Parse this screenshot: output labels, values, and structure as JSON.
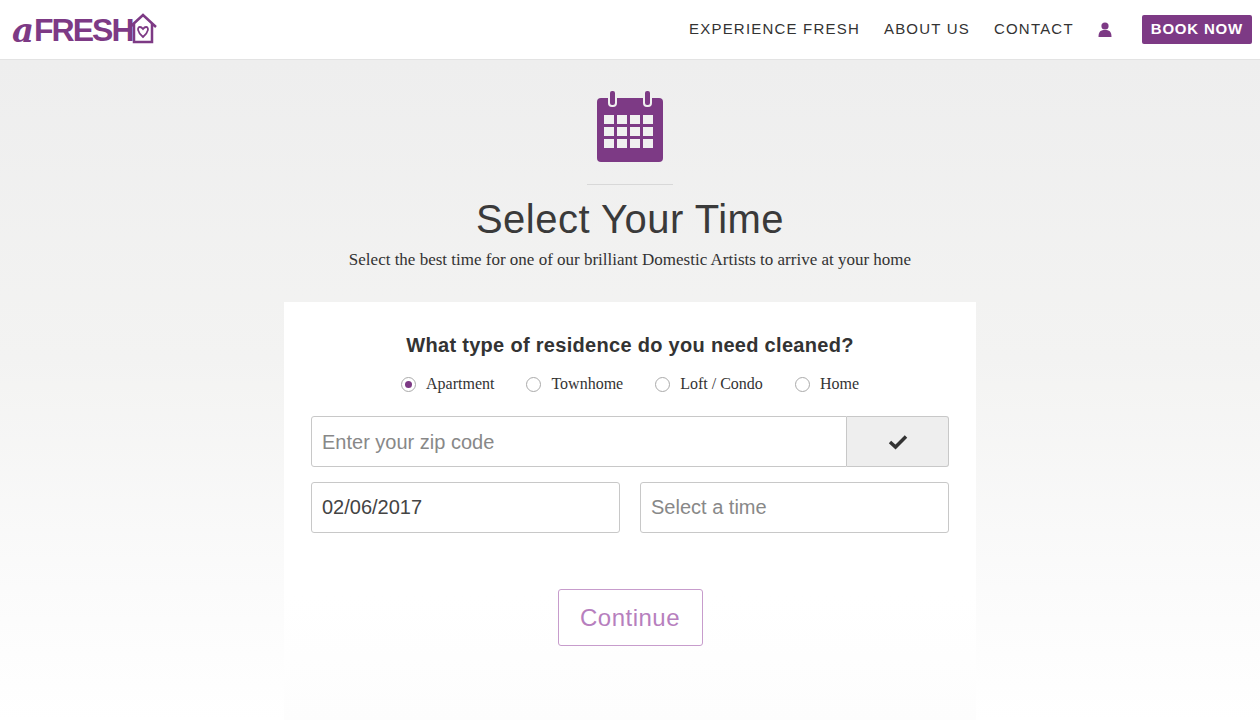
{
  "header": {
    "logo": {
      "prefix": "a",
      "name": "FRESH"
    },
    "nav": [
      "EXPERIENCE FRESH",
      "ABOUT US",
      "CONTACT"
    ],
    "book_button": "BOOK NOW"
  },
  "hero": {
    "title": "Select Your Time",
    "subtitle": "Select the best time for one of our brilliant Domestic Artists to arrive at your home"
  },
  "form": {
    "question": "What type of residence do you need cleaned?",
    "residence_types": [
      {
        "label": "Apartment",
        "selected": true
      },
      {
        "label": "Townhome",
        "selected": false
      },
      {
        "label": "Loft / Condo",
        "selected": false
      },
      {
        "label": "Home",
        "selected": false
      }
    ],
    "zip": {
      "placeholder": "Enter your zip code"
    },
    "date": {
      "value": "02/06/2017"
    },
    "time": {
      "placeholder": "Select a time"
    },
    "continue_button": {
      "label": "Continue",
      "disabled": true
    }
  }
}
